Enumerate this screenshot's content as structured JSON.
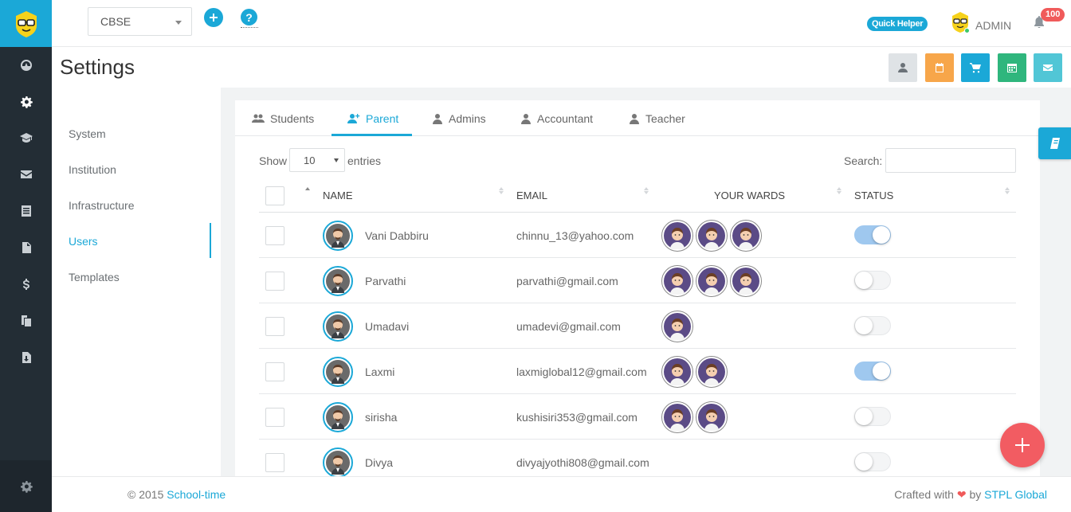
{
  "topbar": {
    "board_select": "CBSE",
    "quick_helper": "Quick Helper",
    "admin_label": "ADMIN",
    "notifications_count": "100"
  },
  "page": {
    "title": "Settings"
  },
  "header_buttons": [
    {
      "name": "profile-button",
      "icon": "user-icon",
      "color": "#dfe3e6"
    },
    {
      "name": "calendar-button",
      "icon": "calendar-icon",
      "color": "#f7a64a"
    },
    {
      "name": "cart-button",
      "icon": "cart-icon",
      "color": "#1ba8d7"
    },
    {
      "name": "schedule-button",
      "icon": "calendar-grid-icon",
      "color": "#2fb67d"
    },
    {
      "name": "mail-button",
      "icon": "mail-icon",
      "color": "#51c6d6"
    }
  ],
  "settings_menu": {
    "items": [
      {
        "label": "System"
      },
      {
        "label": "Institution"
      },
      {
        "label": "Infrastructure"
      },
      {
        "label": "Users",
        "active": true
      },
      {
        "label": "Templates"
      }
    ]
  },
  "tabs": [
    {
      "label": "Students",
      "icon": "users-icon"
    },
    {
      "label": "Parent",
      "icon": "user-plus-icon",
      "active": true
    },
    {
      "label": "Admins",
      "icon": "user-icon"
    },
    {
      "label": "Accountant",
      "icon": "user-tie-icon"
    },
    {
      "label": "Teacher",
      "icon": "user-icon"
    }
  ],
  "table_controls": {
    "show_label": "Show",
    "entries_value": "10",
    "entries_label": "entries",
    "search_label": "Search:"
  },
  "table": {
    "columns": [
      "NAME",
      "EMAIL",
      "YOUR WARDS",
      "STATUS"
    ],
    "rows": [
      {
        "name": "Vani Dabbiru",
        "email": "chinnu_13@yahoo.com",
        "wards": 3,
        "status": true
      },
      {
        "name": "Parvathi",
        "email": "parvathi@gmail.com",
        "wards": 3,
        "status": false
      },
      {
        "name": "Umadavi",
        "email": "umadevi@gmail.com",
        "wards": 1,
        "status": false
      },
      {
        "name": "Laxmi",
        "email": "laxmiglobal12@gmail.com",
        "wards": 2,
        "status": true
      },
      {
        "name": "sirisha",
        "email": "kushisiri353@gmail.com",
        "wards": 2,
        "status": false
      },
      {
        "name": "Divya",
        "email": "divyajyothi808@gmail.com",
        "wards": 0,
        "status": false
      }
    ]
  },
  "footer": {
    "copyright": "© 2015 ",
    "brand": "School-time",
    "crafted_with": "Crafted with ",
    "by": " by ",
    "company": "STPL Global"
  },
  "colors": {
    "accent": "#1ba8d7",
    "sidebar": "#232d35",
    "fab": "#f25c62"
  }
}
